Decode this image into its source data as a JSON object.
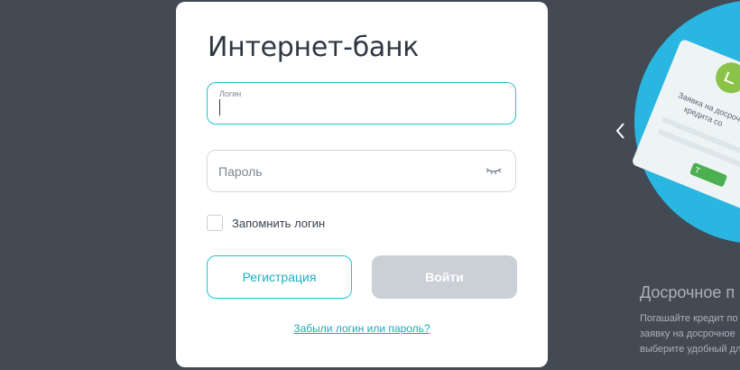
{
  "form": {
    "title": "Интернет-банк",
    "login_label": "Логин",
    "login_value": "",
    "password_placeholder": "Пароль",
    "remember_label": "Запомнить логин",
    "register_button": "Регистрация",
    "login_button": "Войти",
    "forgot_link": "Забыли логин или пароль?"
  },
  "promo": {
    "title": "Досрочное п",
    "lines": [
      "Погашайте кредит по",
      "заявку на досрочное",
      "выберите удобный дл"
    ],
    "card_text_1": "Заявка на досроч",
    "card_text_2": "кредита со",
    "card_button": "Т"
  },
  "icons": {
    "password_toggle": "eye-closed-icon",
    "prev_slide": "chevron-left-icon"
  },
  "colors": {
    "background": "#434a54",
    "accent": "#23c2d6",
    "button_disabled": "#cbd0d6",
    "promo_circle": "#29b6e0",
    "promo_green": "#8bc34a"
  }
}
